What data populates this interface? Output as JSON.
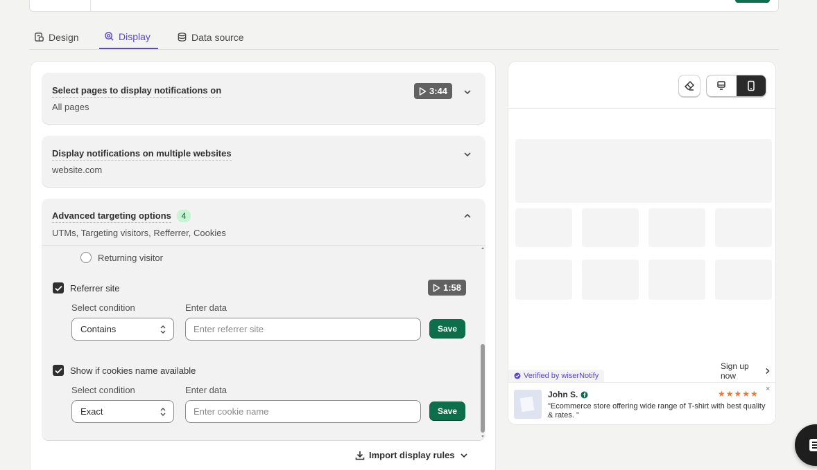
{
  "tabs": [
    {
      "label": "Design",
      "icon": "design-icon",
      "active": false
    },
    {
      "label": "Display",
      "icon": "display-icon",
      "active": true
    },
    {
      "label": "Data source",
      "icon": "database-icon",
      "active": false
    }
  ],
  "cards": {
    "pages": {
      "title": "Select pages to display notifications on",
      "subtitle": "All pages",
      "video": "3:44"
    },
    "websites": {
      "title": "Display notifications on multiple websites",
      "subtitle": "website.com"
    },
    "advanced": {
      "title": "Advanced targeting options",
      "count": "4",
      "subtitle": "UTMs, Targeting visitors, Refferrer, Cookies",
      "returning_visitor": "Returning visitor",
      "referrer": {
        "label": "Referrer site",
        "checked": true,
        "video": "1:58",
        "condition_label": "Select condition",
        "condition_value": "Contains",
        "data_label": "Enter data",
        "placeholder": "Enter referrer site",
        "save": "Save"
      },
      "cookies": {
        "label": "Show if cookies name available",
        "checked": true,
        "condition_label": "Select condition",
        "condition_value": "Exact",
        "data_label": "Enter data",
        "placeholder": "Enter cookie name",
        "save": "Save"
      }
    }
  },
  "import_label": "Import display rules",
  "preview": {
    "sign_up": "Sign up now",
    "verified": "Verified by wiserNotify",
    "name": "John S.",
    "stars": "★★★★★",
    "quote": "\"Ecommerce store offering wide range of T-shirt with best quality & rates. \"",
    "close": "×"
  },
  "colors": {
    "accent": "#5b49c8",
    "primary": "#0c6e4b",
    "badge": "#c8f4d2"
  }
}
